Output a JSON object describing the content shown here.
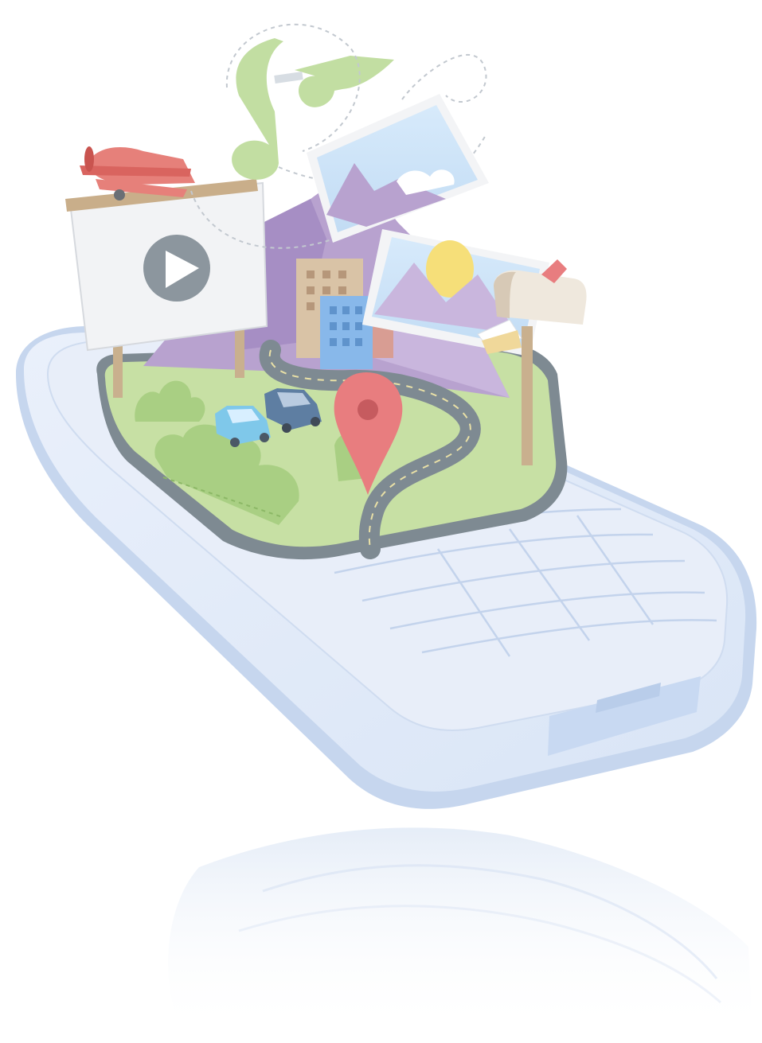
{
  "illustration": {
    "subject": "mobile-phone-with-pop-up-world",
    "icons": [
      "play-icon",
      "map-pin-icon",
      "music-note-icon",
      "mailbox-icon",
      "airplane-icon"
    ]
  },
  "colors": {
    "phone_body": "#e3ebf8",
    "phone_edge": "#c6d6ee",
    "phone_keys": "#eaf0fb",
    "grass": "#c7e0a4",
    "grass_dark": "#a9cf83",
    "road": "#7e8a92",
    "mountain": "#b8a2cf",
    "mountain_light": "#d5c6e6",
    "building_tan": "#d9c3a6",
    "building_blue": "#88b8ea",
    "map_pin": "#e87d7f",
    "play_button": "#8c969e",
    "airplane": "#e6807a",
    "music_note": "#c2dea2",
    "photo_sky": "#cfe5f8",
    "sun": "#f6df79",
    "car_light_blue": "#7fc8ea",
    "car_dark_blue": "#5e7ea2"
  }
}
